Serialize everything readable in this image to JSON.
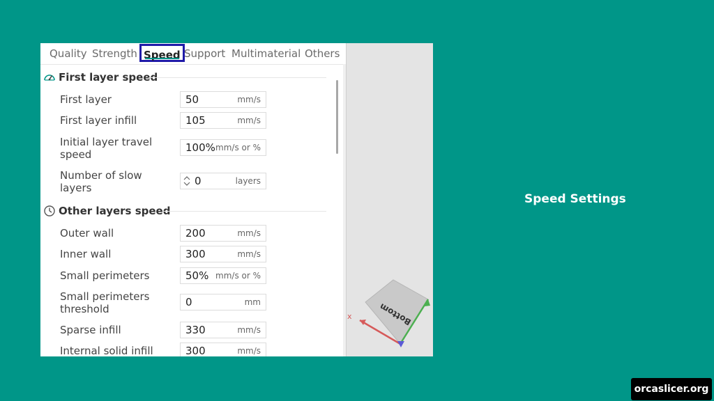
{
  "tabs": [
    "Quality",
    "Strength",
    "Speed",
    "Support",
    "Multimaterial",
    "Others"
  ],
  "active_tab": "Speed",
  "sections": {
    "first_layer": {
      "title": "First layer speed",
      "icon": "speedometer-icon",
      "rows": [
        {
          "label": "First layer",
          "value": "50",
          "unit": "mm/s"
        },
        {
          "label": "First layer infill",
          "value": "105",
          "unit": "mm/s"
        },
        {
          "label": "Initial layer travel speed",
          "value": "100%",
          "unit": "mm/s or %"
        },
        {
          "label": "Number of slow layers",
          "value": "0",
          "unit": "layers"
        }
      ]
    },
    "other_layers": {
      "title": "Other layers speed",
      "icon": "clock-icon",
      "rows": [
        {
          "label": "Outer wall",
          "value": "200",
          "unit": "mm/s"
        },
        {
          "label": "Inner wall",
          "value": "300",
          "unit": "mm/s"
        },
        {
          "label": "Small perimeters",
          "value": "50%",
          "unit": "mm/s or %"
        },
        {
          "label": "Small perimeters threshold",
          "value": "0",
          "unit": "mm"
        },
        {
          "label": "Sparse infill",
          "value": "330",
          "unit": "mm/s"
        },
        {
          "label": "Internal solid infill",
          "value": "300",
          "unit": "mm/s"
        }
      ]
    }
  },
  "viewport": {
    "cube_face_label": "Bottom",
    "axis_x_label": "x",
    "axis_colors": {
      "x": "#d65a5a",
      "y": "#4caf50",
      "z": "#5a5ad6"
    }
  },
  "caption": "Speed Settings",
  "watermark": "orcaslicer.org",
  "colors": {
    "background": "#009688",
    "active_tab_border": "#1f1aa8",
    "accent": "#009688"
  }
}
